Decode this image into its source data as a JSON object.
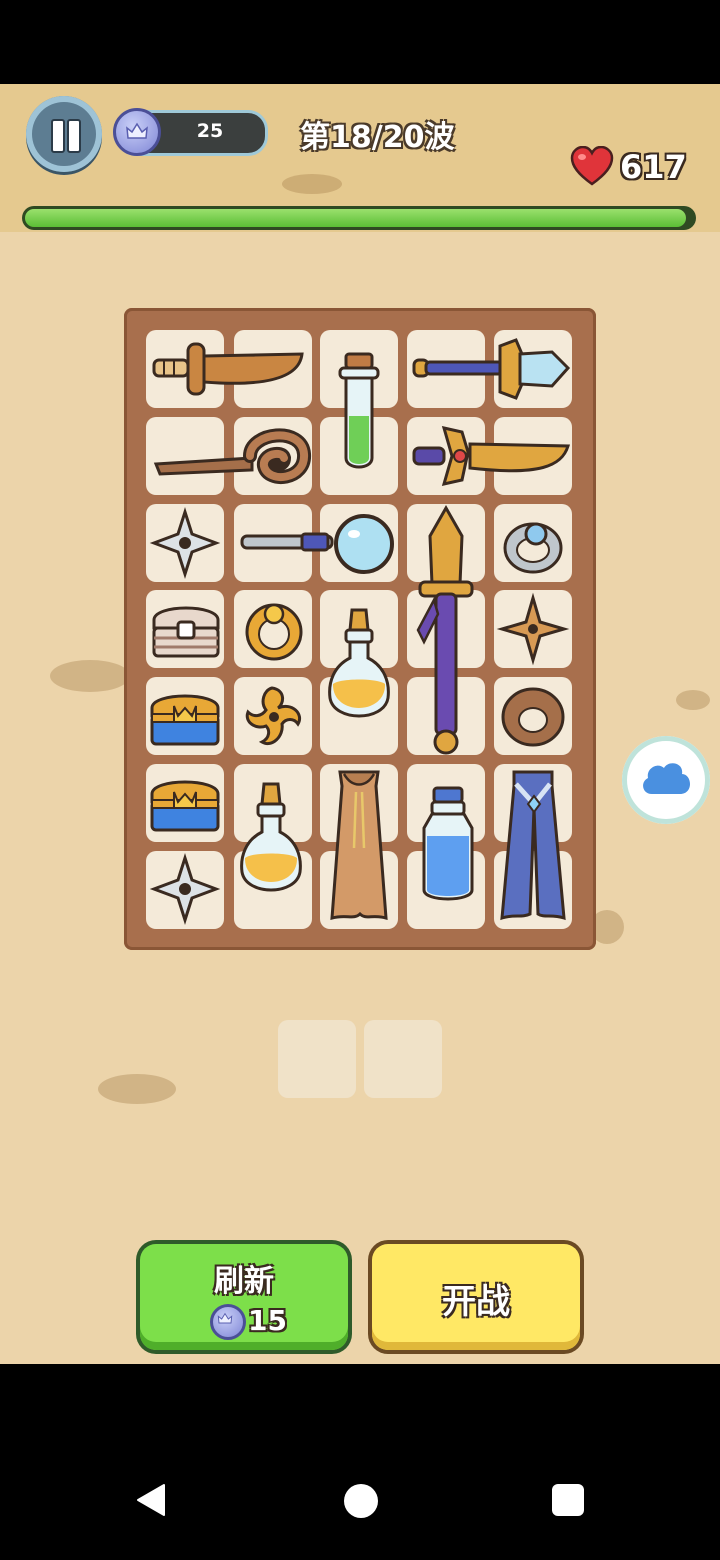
{
  "hud": {
    "coins": "25",
    "wave_text": "第18/20波",
    "hp": "617",
    "progress": 0.99
  },
  "icons": {
    "pause": "pause-icon",
    "coin": "crown-coin-icon",
    "heart": "heart-icon",
    "cloud": "cloud-icon"
  },
  "board": {
    "items": [
      "dagger",
      "potion-green",
      "blue-scepter",
      "wooden-hook-staff",
      "golden-dagger",
      "silver-shuriken",
      "magnifier-wand",
      "bronze-longsword",
      "silver-ring",
      "wooden-chest",
      "gold-ring",
      "potion-yellow",
      "bronze-shuriken",
      "blue-chest",
      "gold-shuriken",
      "wooden-ring",
      "blue-chest",
      "potion-yellow",
      "brown-cloak",
      "potion-blue",
      "blue-cloak",
      "silver-shuriken"
    ]
  },
  "buttons": {
    "refresh_label": "刷新",
    "refresh_cost": "15",
    "fight_label": "开战"
  },
  "colors": {
    "sand": "#ecd4aa",
    "board": "#a86f4d",
    "tile": "#f4ead9",
    "refresh": "#7ddf4a",
    "fight": "#ffe865",
    "progress": "#5bbf35"
  }
}
